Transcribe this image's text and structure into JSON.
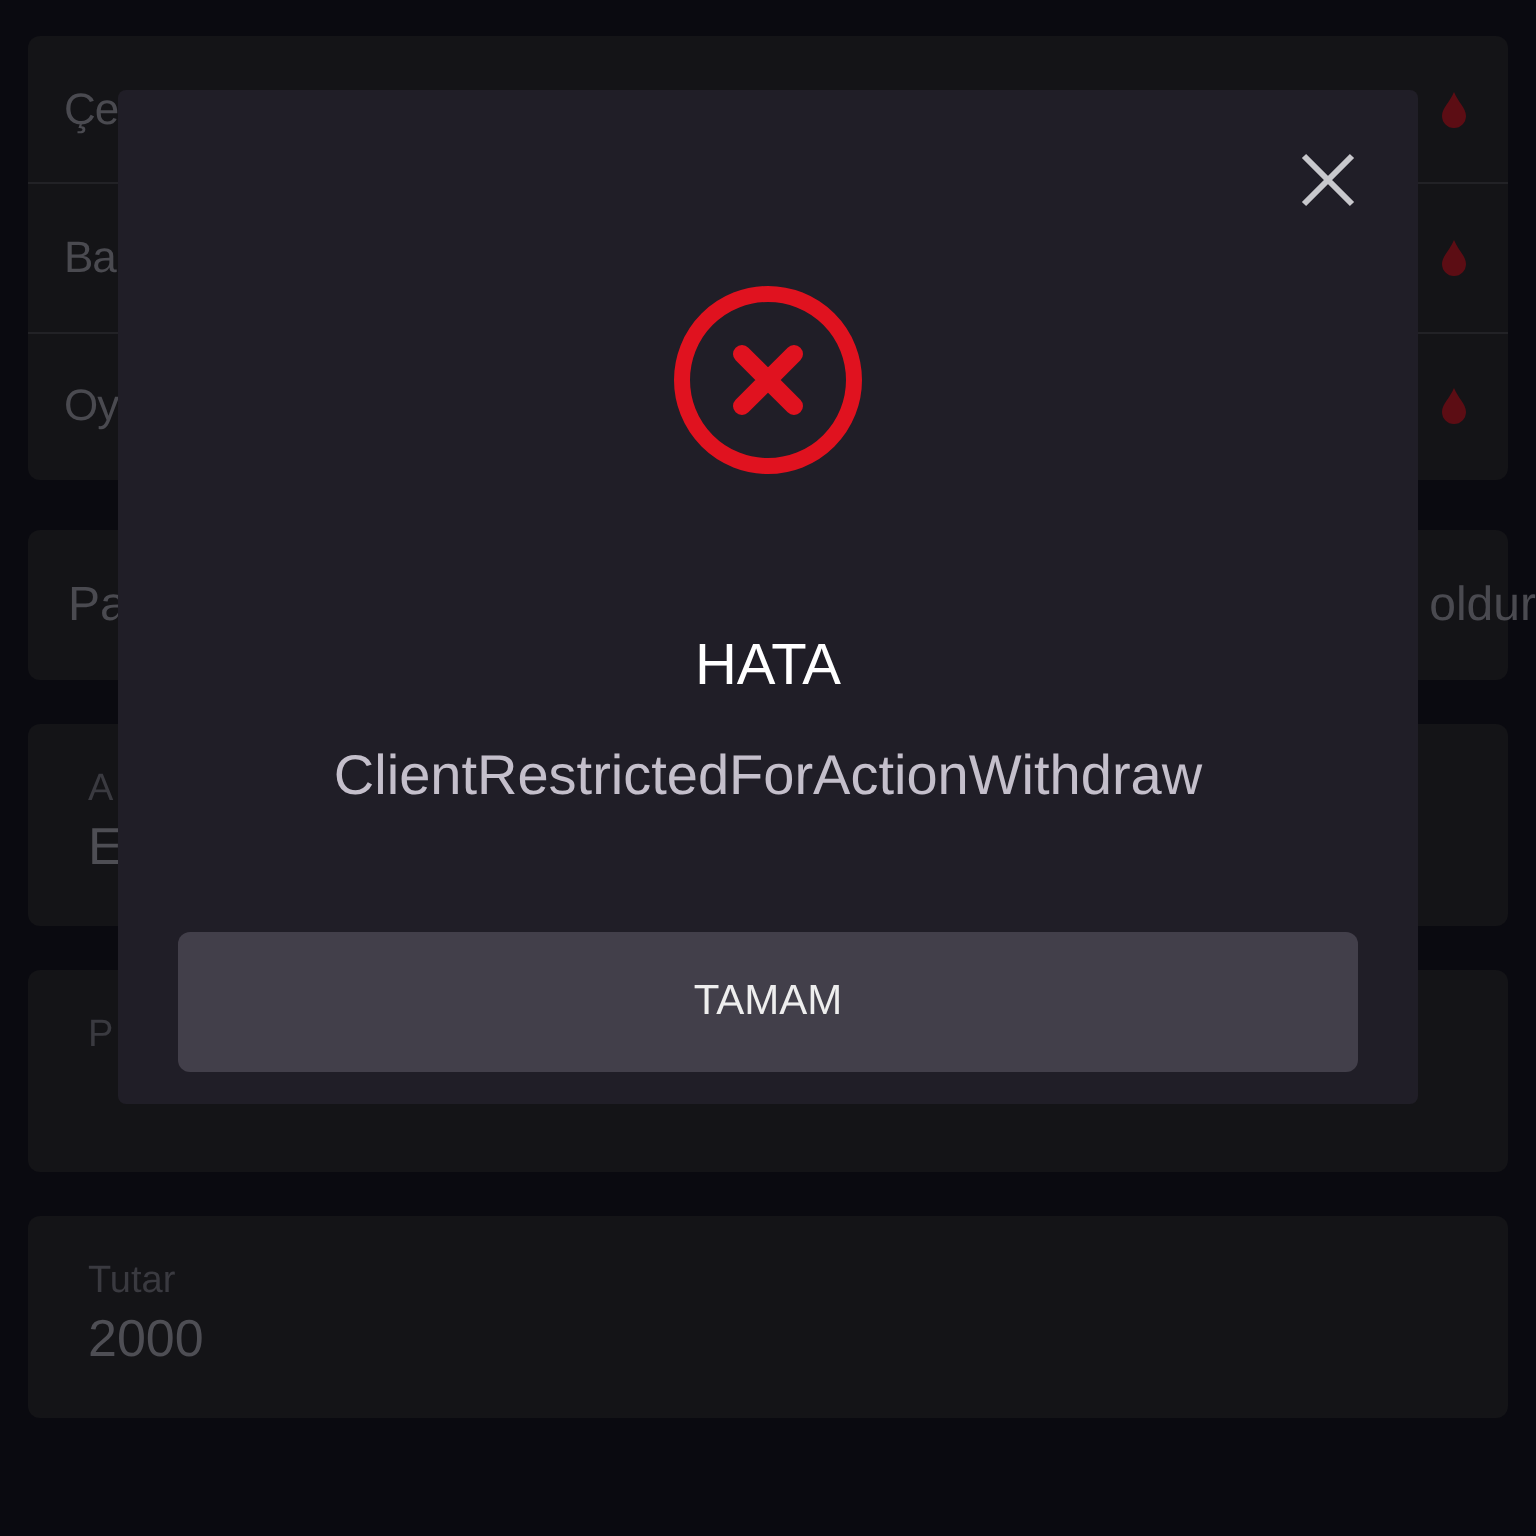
{
  "background": {
    "list_rows": [
      {
        "label": "Çe"
      },
      {
        "label": "Ba"
      },
      {
        "label": "Oy"
      }
    ],
    "info_row": {
      "label": "Pa",
      "trailing": "oldur"
    },
    "fields": [
      {
        "label": "A",
        "value": "E"
      },
      {
        "label": "P"
      },
      {
        "label": "Tutar",
        "value": "2000"
      }
    ]
  },
  "dialog": {
    "title": "HATA",
    "message": "ClientRestrictedForActionWithdraw",
    "button": "TAMAM"
  }
}
